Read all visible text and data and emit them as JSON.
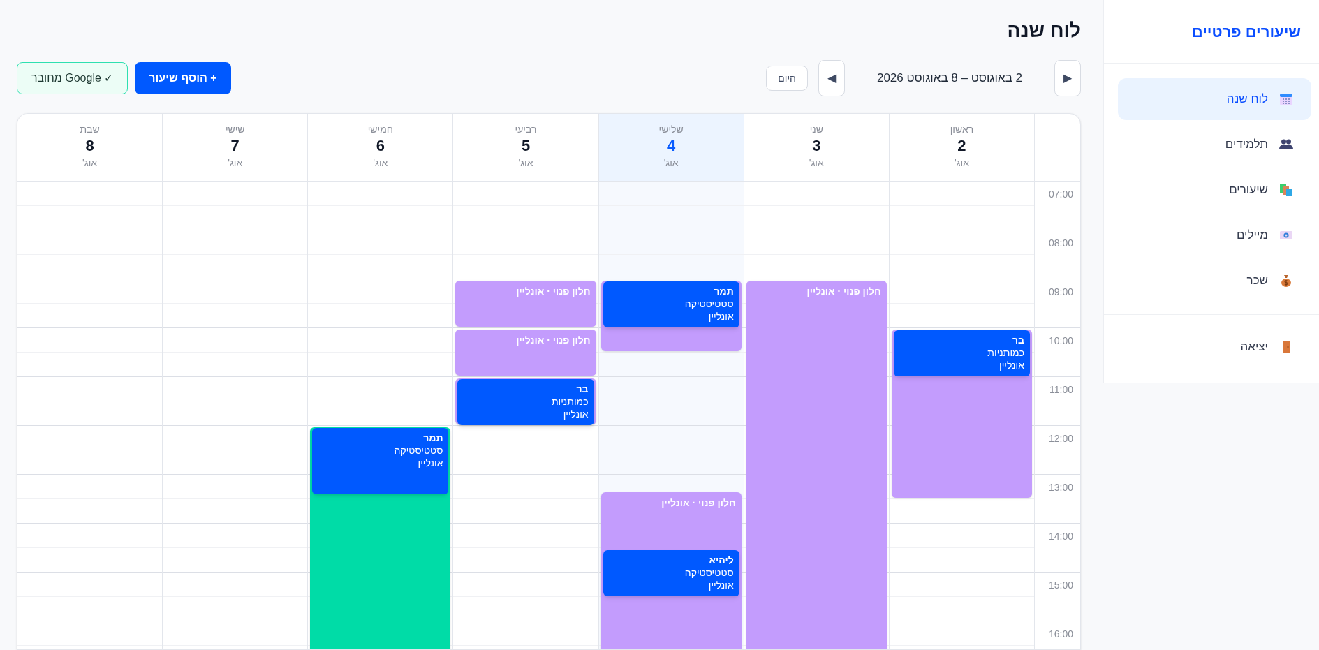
{
  "sidebar": {
    "title": "שיעורים פרטיים",
    "items": [
      {
        "label": "לוח שנה",
        "selected": true
      },
      {
        "label": "תלמידים",
        "selected": false
      },
      {
        "label": "שיעורים",
        "selected": false
      },
      {
        "label": "מיילים",
        "selected": false
      },
      {
        "label": "שכר",
        "selected": false
      }
    ],
    "footer_items": [
      {
        "label": "יציאה"
      }
    ]
  },
  "page": {
    "title": "לוח שנה"
  },
  "toolbar": {
    "next": "▶",
    "range": "2 באוגוסט – 8 באוגוסט 2026",
    "prev": "◀",
    "today": "היום",
    "add_button": "+ הוסף שיעור",
    "google_status": "✓ Google מחובר"
  },
  "calendar": {
    "hours": [
      "07:00",
      "08:00",
      "09:00",
      "10:00",
      "11:00",
      "12:00",
      "13:00",
      "14:00",
      "15:00",
      "16:00"
    ],
    "days": [
      {
        "name": "ראשון",
        "date": "2",
        "month": "אוג'",
        "selected": false,
        "slots": [
          {
            "color": "#c39cfd",
            "lessons": [
              {
                "color": "#0059ff",
                "student": "בר",
                "subject": "כמותניות",
                "mode": "אונליין"
              }
            ]
          }
        ]
      },
      {
        "name": "שני",
        "date": "3",
        "month": "אוג'",
        "selected": false,
        "slots": [
          {
            "color": "#c39cfd",
            "label": "חלון פנוי · אונליין"
          }
        ]
      },
      {
        "name": "שלישי",
        "date": "4",
        "month": "אוג'",
        "selected": true,
        "slots": [
          {
            "color": "#c39cfd",
            "lessons": [
              {
                "color": "#0059ff",
                "student": "תמר",
                "subject": "סטטיסטיקה",
                "mode": "אונליין"
              }
            ]
          },
          {
            "color": "#c39cfd",
            "label": "חלון פנוי · אונליין",
            "lessons": [
              {
                "color": "#0059ff",
                "student": "ליהיא",
                "subject": "סטטיסטיקה",
                "mode": "אונליין"
              }
            ]
          }
        ]
      },
      {
        "name": "רביעי",
        "date": "5",
        "month": "אוג'",
        "selected": false,
        "slots": [
          {
            "color": "#c39cfd",
            "label": "חלון פנוי · אונליין"
          },
          {
            "color": "#c39cfd",
            "label": "חלון פנוי · אונליין"
          },
          {
            "color": "#c39cfd",
            "lessons": [
              {
                "color": "#0059ff",
                "student": "בר",
                "subject": "כמותניות",
                "mode": "אונליין"
              }
            ]
          }
        ]
      },
      {
        "name": "חמישי",
        "date": "6",
        "month": "אוג'",
        "selected": false,
        "slots": [
          {
            "color": "#00dca7",
            "lessons": [
              {
                "color": "#0059ff",
                "student": "תמר",
                "subject": "סטטיסטיקה",
                "mode": "אונליין"
              }
            ]
          }
        ]
      },
      {
        "name": "שישי",
        "date": "7",
        "month": "אוג'",
        "selected": false
      },
      {
        "name": "שבת",
        "date": "8",
        "month": "אוג'",
        "selected": false
      }
    ]
  }
}
